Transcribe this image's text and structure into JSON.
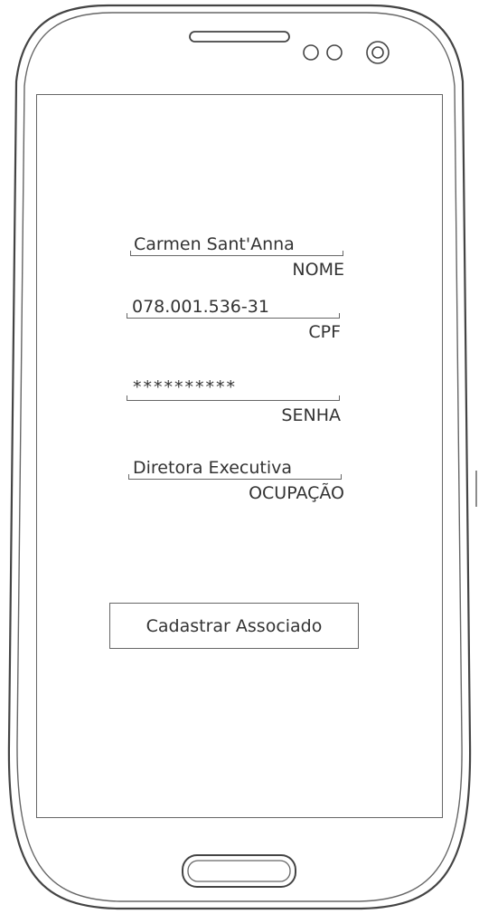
{
  "form": {
    "nome": {
      "value": "Carmen Sant'Anna",
      "label": "NOME"
    },
    "cpf": {
      "value": "078.001.536-31",
      "label": "CPF"
    },
    "senha": {
      "value": "**********",
      "label": "SENHA"
    },
    "ocupacao": {
      "value": "Diretora Executiva",
      "label": "OCUPAÇÃO"
    }
  },
  "submit_label": "Cadastrar Associado",
  "colors": {
    "stroke": "#555555",
    "text": "#333333",
    "background": "#ffffff"
  }
}
